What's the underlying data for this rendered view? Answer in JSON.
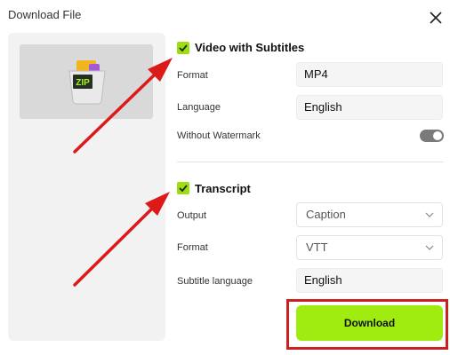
{
  "dialog": {
    "title": "Download File"
  },
  "preview": {
    "badge": "ZIP"
  },
  "video_section": {
    "title": "Video with Subtitles",
    "checked": true,
    "format_label": "Format",
    "format_value": "MP4",
    "language_label": "Language",
    "language_value": "English",
    "watermark_label": "Without Watermark",
    "watermark_on": true
  },
  "transcript_section": {
    "title": "Transcript",
    "checked": true,
    "output_label": "Output",
    "output_value": "Caption",
    "format_label": "Format",
    "format_value": "VTT",
    "subtitle_language_label": "Subtitle language",
    "subtitle_language_value": "English"
  },
  "download_button": {
    "label": "Download"
  },
  "colors": {
    "accent": "#a0ec10",
    "annotation": "#dd1a1a"
  }
}
